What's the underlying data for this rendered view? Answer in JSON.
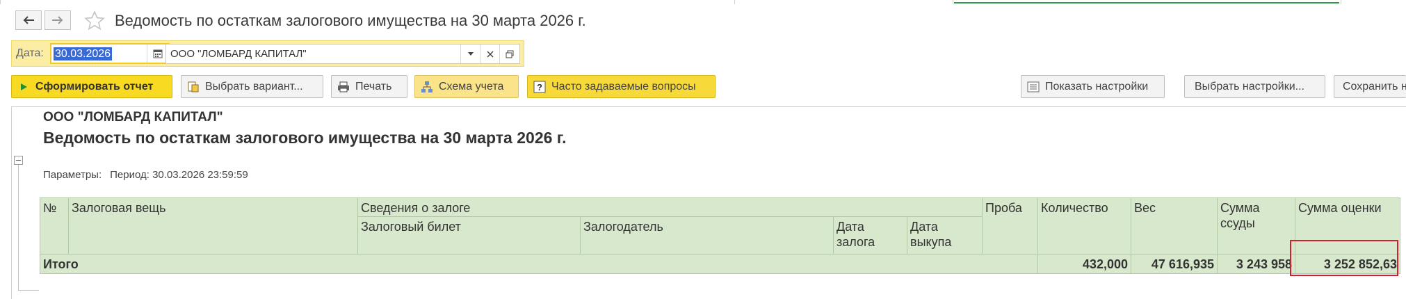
{
  "window": {
    "title": "Ведомость по остаткам залогового имущества на 30 марта 2026 г.",
    "back_icon": "arrow-left-icon",
    "forward_icon": "arrow-right-icon",
    "favorite_icon": "star-icon"
  },
  "filter": {
    "date_label": "Дата:",
    "date_value": "30.03.2026",
    "organization": "ООО \"ЛОМБАРД КАПИТАЛ\""
  },
  "toolbar": {
    "generate": "Сформировать отчет",
    "choose_variant": "Выбрать вариант...",
    "print": "Печать",
    "accounting_scheme": "Схема учета",
    "faq": "Часто задаваемые вопросы",
    "show_settings": "Показать настройки",
    "choose_settings": "Выбрать настройки...",
    "save": "Сохранить н"
  },
  "report": {
    "organization": "ООО \"ЛОМБАРД КАПИТАЛ\"",
    "title": "Ведомость по остаткам залогового имущества на 30 марта 2026 г.",
    "params_label": "Параметры:",
    "params_value": "Период: 30.03.2026 23:59:59",
    "headers": {
      "num": "№",
      "item": "Залоговая вещь",
      "pledge_info": "Сведения о залоге",
      "ticket": "Залоговый билет",
      "pledger": "Залогодатель",
      "pledge_date": "Дата залога",
      "redeem_date": "Дата выкупа",
      "fineness": "Проба",
      "quantity": "Количество",
      "weight": "Вес",
      "loan_sum": "Сумма ссуды",
      "appraisal_sum": "Сумма оценки"
    },
    "total": {
      "label": "Итого",
      "quantity": "432,000",
      "weight": "47 616,935",
      "loan_sum": "3 243 958",
      "appraisal_sum": "3 252 852,63"
    }
  },
  "colors": {
    "accent_yellow": "#f8da22",
    "filter_bg": "#fbeea4",
    "table_bg": "#d8e8cc",
    "highlight": "#d3202a",
    "selection": "#3869d4"
  }
}
